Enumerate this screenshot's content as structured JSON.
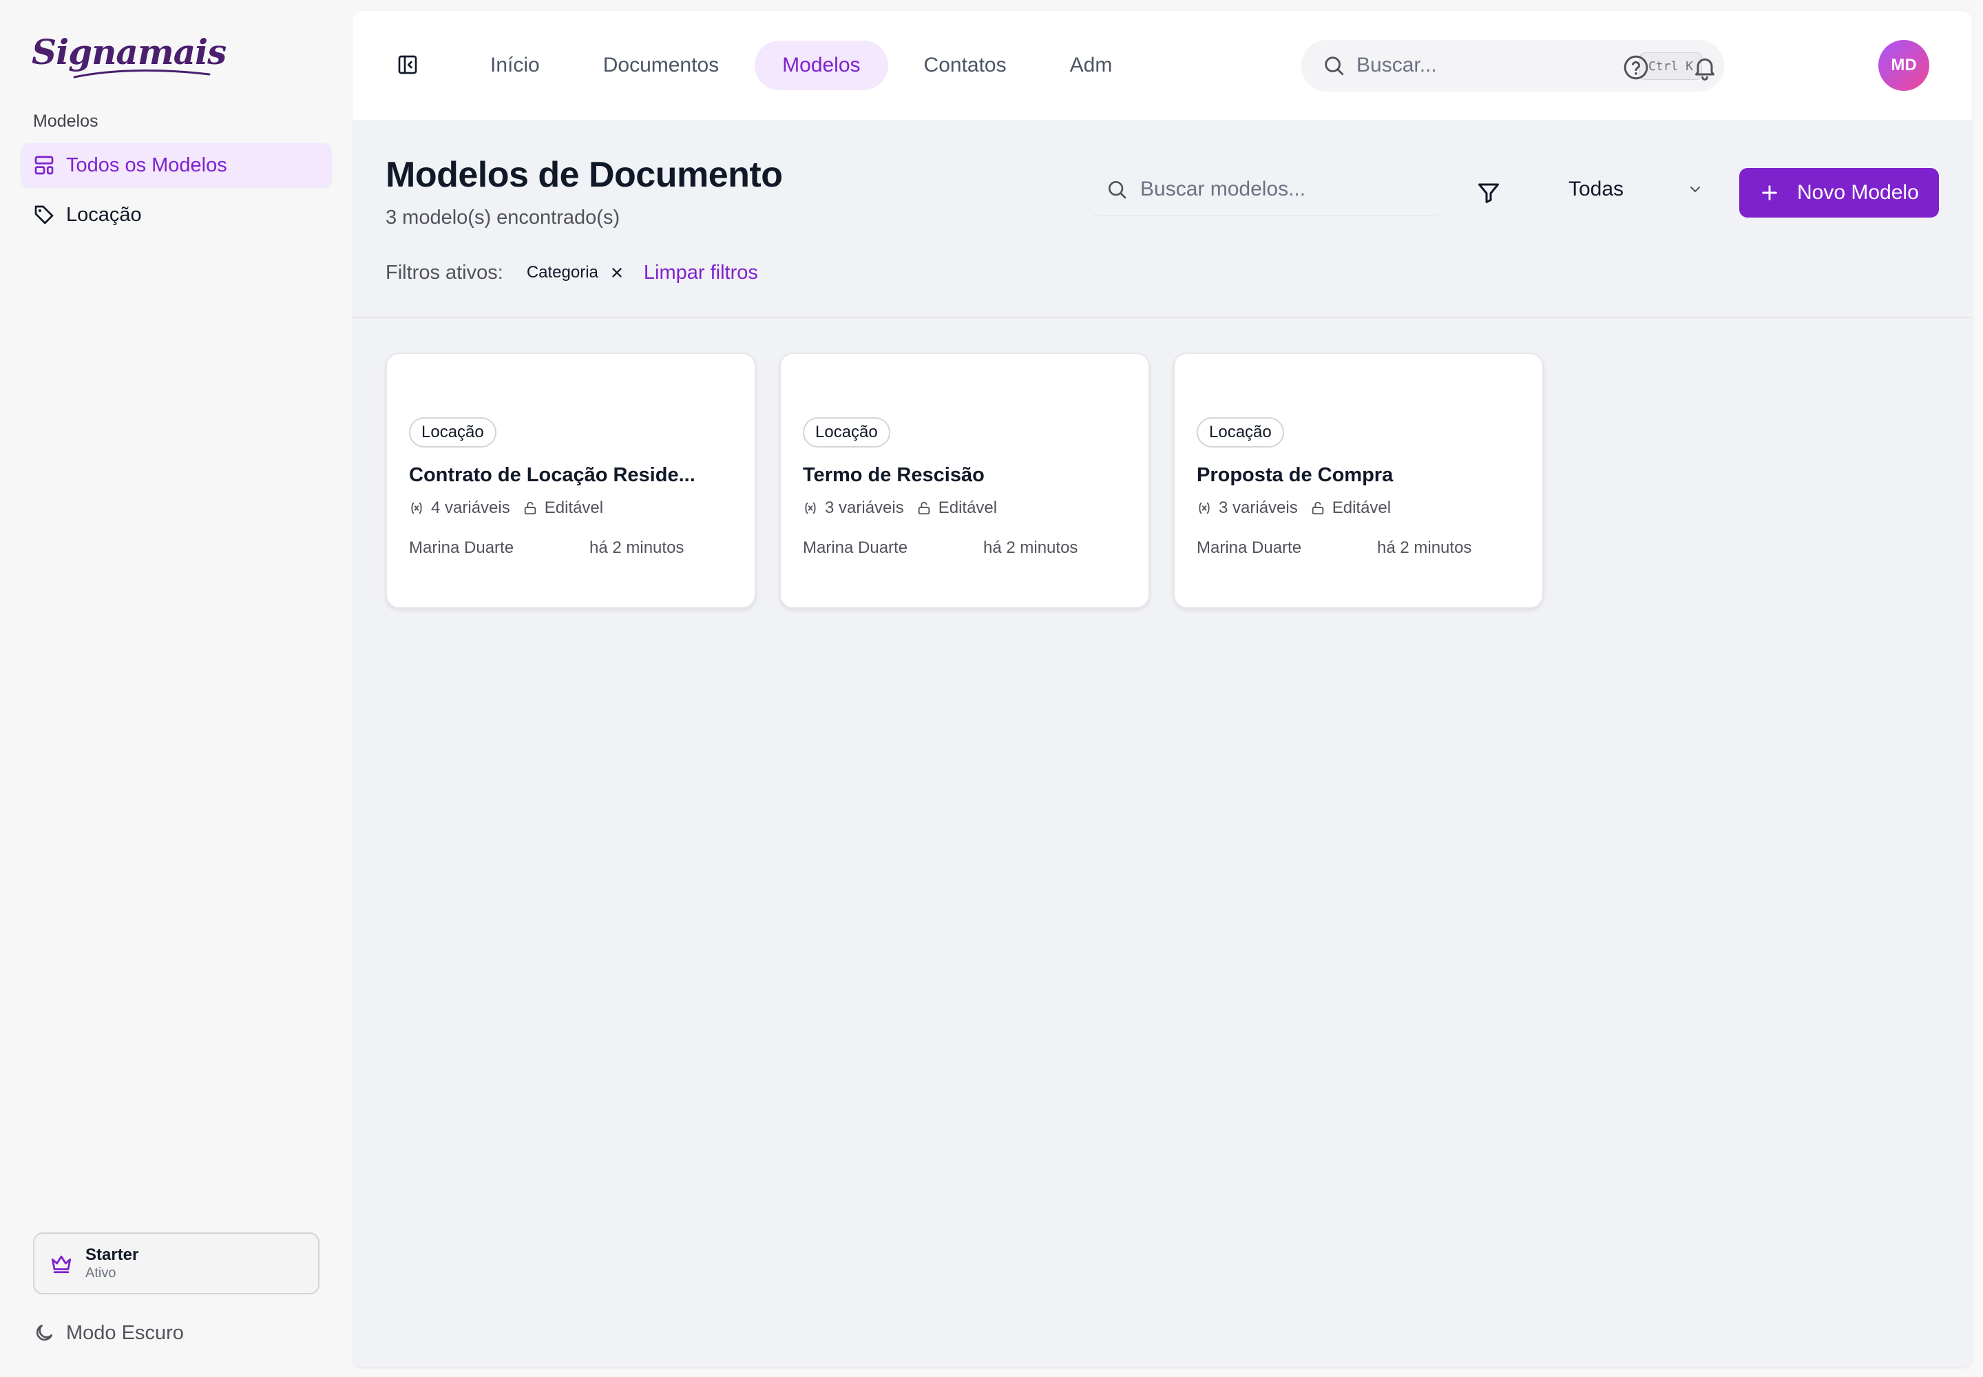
{
  "brand": {
    "name": "Signamais"
  },
  "sidebar": {
    "section_label": "Modelos",
    "items": [
      {
        "label": "Todos os Modelos",
        "icon": "templates-icon",
        "active": true
      },
      {
        "label": "Locação",
        "icon": "tag-icon",
        "active": false
      }
    ],
    "plan": {
      "name": "Starter",
      "status": "Ativo",
      "icon": "crown-icon"
    },
    "dark_mode_label": "Modo Escuro"
  },
  "topbar": {
    "tabs": [
      {
        "label": "Início",
        "active": false
      },
      {
        "label": "Documentos",
        "active": false
      },
      {
        "label": "Modelos",
        "active": true
      },
      {
        "label": "Contatos",
        "active": false
      },
      {
        "label": "Adm",
        "active": false
      }
    ],
    "search": {
      "placeholder": "Buscar...",
      "shortcut": "Ctrl K"
    },
    "avatar_initials": "MD"
  },
  "page": {
    "title": "Modelos de Documento",
    "count_text": "3 modelo(s) encontrado(s)",
    "search_placeholder": "Buscar modelos...",
    "category_select": "Todas",
    "new_button": "Novo Modelo",
    "filters_label": "Filtros ativos:",
    "active_filters": [
      "Categoria"
    ],
    "clear_filters": "Limpar filtros"
  },
  "cards": [
    {
      "category": "Locação",
      "title": "Contrato de Locação Reside...",
      "variables": "4 variáveis",
      "editable": "Editável",
      "author": "Marina Duarte",
      "time": "há 2 minutos"
    },
    {
      "category": "Locação",
      "title": "Termo de Rescisão",
      "variables": "3 variáveis",
      "editable": "Editável",
      "author": "Marina Duarte",
      "time": "há 2 minutos"
    },
    {
      "category": "Locação",
      "title": "Proposta de Compra",
      "variables": "3 variáveis",
      "editable": "Editável",
      "author": "Marina Duarte",
      "time": "há 2 minutos"
    }
  ],
  "colors": {
    "accent": "#7e22ce",
    "accent_soft": "#f3e8fd",
    "background": "#f1f2f6"
  }
}
